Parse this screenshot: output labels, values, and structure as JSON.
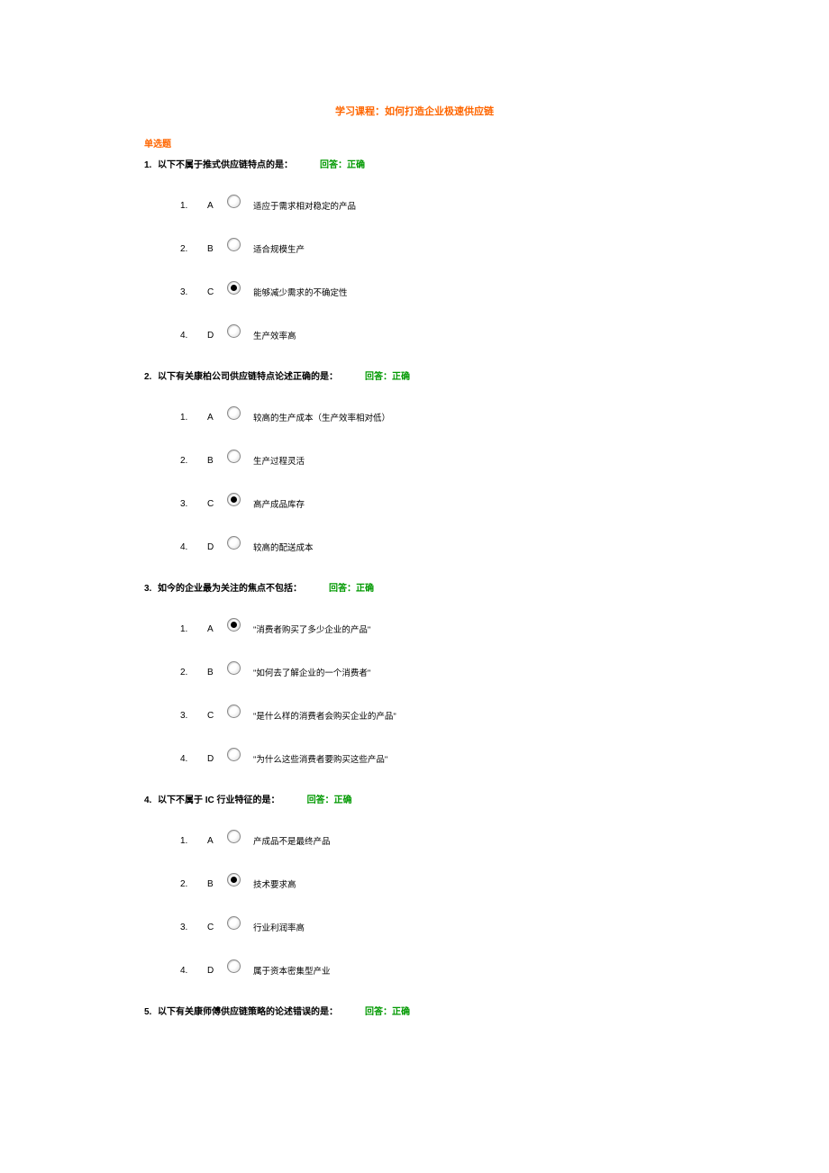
{
  "page_title": "学习课程：如何打造企业极速供应链",
  "section_heading": "单选题",
  "answer_prefix": "回答：",
  "answer_result": "正确",
  "questions": [
    {
      "num": "1.",
      "text": "以下不属于推式供应链特点的是：",
      "selected": 2,
      "options": [
        {
          "num": "1.",
          "letter": "A",
          "text": "适应于需求相对稳定的产品"
        },
        {
          "num": "2.",
          "letter": "B",
          "text": "适合规模生产"
        },
        {
          "num": "3.",
          "letter": "C",
          "text": "能够减少需求的不确定性"
        },
        {
          "num": "4.",
          "letter": "D",
          "text": "生产效率高"
        }
      ]
    },
    {
      "num": "2.",
      "text": "以下有关康柏公司供应链特点论述正确的是：",
      "selected": 2,
      "options": [
        {
          "num": "1.",
          "letter": "A",
          "text": "较高的生产成本（生产效率相对低）"
        },
        {
          "num": "2.",
          "letter": "B",
          "text": "生产过程灵活"
        },
        {
          "num": "3.",
          "letter": "C",
          "text": "高产成品库存"
        },
        {
          "num": "4.",
          "letter": "D",
          "text": "较高的配送成本"
        }
      ]
    },
    {
      "num": "3.",
      "text": "如今的企业最为关注的焦点不包括：",
      "selected": 0,
      "options": [
        {
          "num": "1.",
          "letter": "A",
          "text": "\"消费者购买了多少企业的产品\""
        },
        {
          "num": "2.",
          "letter": "B",
          "text": "\"如何去了解企业的一个消费者\""
        },
        {
          "num": "3.",
          "letter": "C",
          "text": "\"是什么样的消费者会购买企业的产品\""
        },
        {
          "num": "4.",
          "letter": "D",
          "text": "\"为什么这些消费者要购买这些产品\""
        }
      ]
    },
    {
      "num": "4.",
      "text": "以下不属于 IC 行业特征的是：",
      "selected": 1,
      "options": [
        {
          "num": "1.",
          "letter": "A",
          "text": "产成品不是最终产品"
        },
        {
          "num": "2.",
          "letter": "B",
          "text": "技术要求高"
        },
        {
          "num": "3.",
          "letter": "C",
          "text": "行业利润率高"
        },
        {
          "num": "4.",
          "letter": "D",
          "text": "属于资本密集型产业"
        }
      ]
    },
    {
      "num": "5.",
      "text": "以下有关康师傅供应链策略的论述错误的是：",
      "selected": -1,
      "options": []
    }
  ]
}
